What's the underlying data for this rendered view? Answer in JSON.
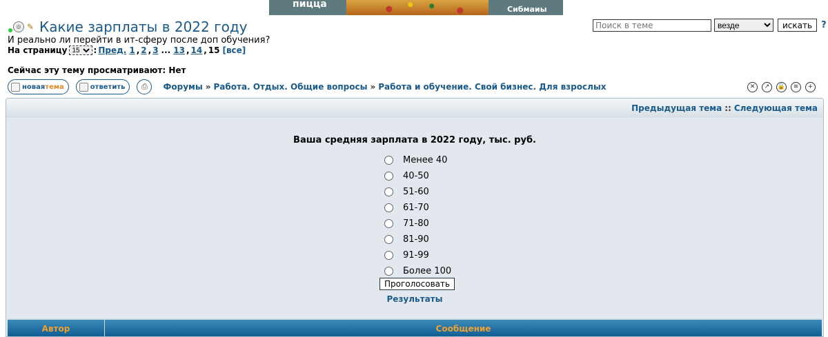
{
  "banner": {
    "left_text": "пицца",
    "right_text": "Сибмаиы"
  },
  "topic": {
    "title": "Какие зарплаты в 2022 году",
    "subtitle": "И реально ли перейти в ит-сферу после доп обучения?"
  },
  "pagination": {
    "label": "На страницу",
    "selected": "15",
    "prev": "Пред.",
    "pages": [
      "1",
      "2",
      "3"
    ],
    "ellipsis": "...",
    "pages_end": [
      "13",
      "14"
    ],
    "current": "15",
    "all": "[все]"
  },
  "viewing": "Сейчас эту тему просматривают: Нет",
  "search": {
    "placeholder": "Поиск в теме",
    "scope": "везде",
    "button": "искать",
    "help": "?"
  },
  "actions": {
    "new_topic_a": "новая",
    "new_topic_b": "тема",
    "reply": "ответить"
  },
  "breadcrumb": [
    "Форумы",
    "Работа. Отдых. Общие вопросы",
    "Работа и обучение. Свой бизнес. Для взрослых"
  ],
  "breadcrumb_sep": "»",
  "nav": {
    "prev": "Предыдущая тема",
    "sep": "::",
    "next": "Следующая тема"
  },
  "poll": {
    "question": "Ваша средняя зарплата в 2022 году, тыс. руб.",
    "options": [
      "Менее 40",
      "40-50",
      "51-60",
      "61-70",
      "71-80",
      "81-90",
      "91-99",
      "Более 100"
    ],
    "vote": "Проголосовать",
    "results": "Результаты"
  },
  "table_headers": {
    "author": "Автор",
    "message": "Сообщение"
  },
  "colors": {
    "link": "#1a5a8a",
    "header_text": "#f0a030",
    "header_bg": "#0d5a90",
    "panel_bg": "#e2e8ee"
  }
}
